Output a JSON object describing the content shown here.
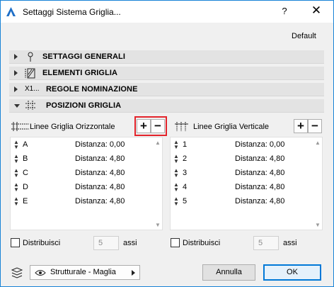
{
  "window": {
    "title": "Settaggi Sistema Griglia...",
    "help": "?",
    "close": "✕"
  },
  "header": {
    "default_label": "Default"
  },
  "sections": [
    {
      "label": "SETTAGGI GENERALI",
      "icon": "pin-icon",
      "expanded": false
    },
    {
      "label": "ELEMENTI GRIGLIA",
      "icon": "grid-element-icon",
      "expanded": false
    },
    {
      "label": "REGOLE NOMINAZIONE",
      "icon": "naming-icon",
      "icon_text": "X1...",
      "expanded": false
    },
    {
      "label": "POSIZIONI GRIGLIA",
      "icon": "grid-positions-icon",
      "expanded": true
    }
  ],
  "horizontal": {
    "label": "Linee Griglia Orizzontale",
    "add": "+",
    "remove": "−",
    "rows": [
      {
        "name": "A",
        "distance": "Distanza: 0,00"
      },
      {
        "name": "B",
        "distance": "Distanza: 4,80"
      },
      {
        "name": "C",
        "distance": "Distanza: 4,80"
      },
      {
        "name": "D",
        "distance": "Distanza: 4,80"
      },
      {
        "name": "E",
        "distance": "Distanza: 4,80"
      }
    ],
    "distribute_label": "Distribuisci",
    "distribute_value": "5",
    "axes_label": "assi"
  },
  "vertical": {
    "label": "Linee Griglia Verticale",
    "add": "+",
    "remove": "−",
    "rows": [
      {
        "name": "1",
        "distance": "Distanza: 0,00"
      },
      {
        "name": "2",
        "distance": "Distanza: 4,80"
      },
      {
        "name": "3",
        "distance": "Distanza: 4,80"
      },
      {
        "name": "4",
        "distance": "Distanza: 4,80"
      },
      {
        "name": "5",
        "distance": "Distanza: 4,80"
      }
    ],
    "distribute_label": "Distribuisci",
    "distribute_value": "5",
    "axes_label": "assi"
  },
  "footer": {
    "layer_value": "Strutturale - Maglia",
    "cancel_label": "Annulla",
    "ok_label": "OK"
  },
  "colors": {
    "window_border": "#1883d7",
    "highlight": "#e3242b",
    "primary_border": "#0078d7"
  }
}
